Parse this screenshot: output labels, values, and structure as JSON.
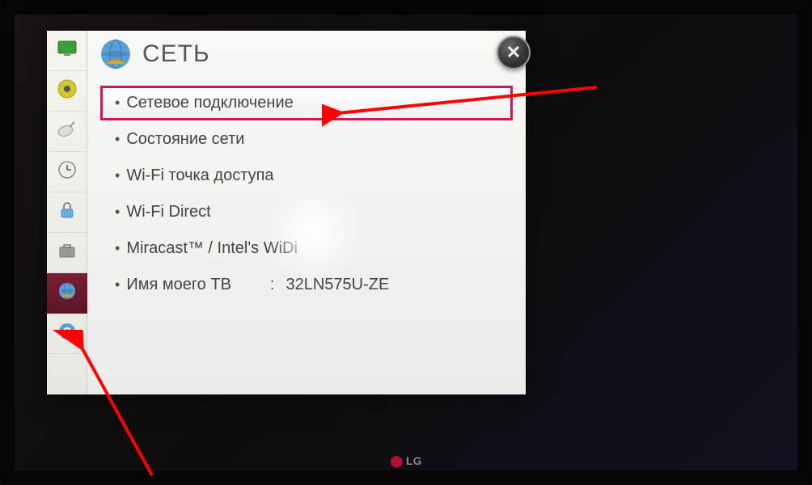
{
  "header": {
    "title": "СЕТЬ"
  },
  "close": {
    "symbol": "✕"
  },
  "sidebar": {
    "items": [
      {
        "name": "picture",
        "active": false
      },
      {
        "name": "sound",
        "active": false
      },
      {
        "name": "channel",
        "active": false
      },
      {
        "name": "time",
        "active": false
      },
      {
        "name": "lock",
        "active": false
      },
      {
        "name": "option",
        "active": false
      },
      {
        "name": "network",
        "active": true
      },
      {
        "name": "support",
        "active": false
      }
    ]
  },
  "menu": {
    "items": [
      {
        "label": "Сетевое подключение",
        "selected": true
      },
      {
        "label": "Состояние сети",
        "selected": false
      },
      {
        "label": "Wi-Fi точка доступа",
        "selected": false
      },
      {
        "label": "Wi-Fi Direct",
        "selected": false
      },
      {
        "label": "Miracast™ / Intel's WiDi",
        "selected": false
      },
      {
        "label": "Имя моего ТВ",
        "value": "32LN575U-ZE",
        "selected": false
      }
    ]
  },
  "tv": {
    "brand": "LG"
  },
  "annotation": {
    "color": "#ff0000"
  }
}
